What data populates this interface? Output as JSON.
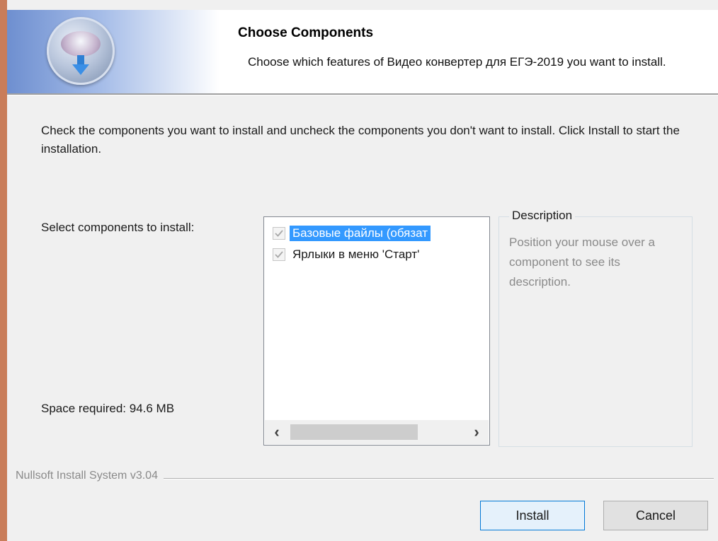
{
  "header": {
    "title": "Choose Components",
    "subtitle": "Choose which features of Видео конвертер для ЕГЭ-2019 you want to install."
  },
  "body": {
    "instruction": "Check the components you want to install and uncheck the components you don't want to install. Click Install to start the installation.",
    "select_label": "Select components to install:",
    "space_required": "Space required: 94.6 MB"
  },
  "components": [
    {
      "label": "Базовые файлы (обязат",
      "checked": true,
      "selected": true
    },
    {
      "label": "Ярлыки в меню 'Старт'",
      "checked": true,
      "selected": false
    }
  ],
  "scrollbar": {
    "left_glyph": "‹",
    "right_glyph": "›"
  },
  "description": {
    "title": "Description",
    "text": "Position your mouse over a component to see its description."
  },
  "footer": {
    "brand": "Nullsoft Install System v3.04"
  },
  "buttons": {
    "install": "Install",
    "cancel": "Cancel"
  },
  "colors": {
    "selection": "#3399ff",
    "accent_border": "#c97d5a",
    "default_button_border": "#0078d7"
  },
  "icons": {
    "logo": "installer-disc-icon",
    "checkbox": "checkmark-icon"
  }
}
